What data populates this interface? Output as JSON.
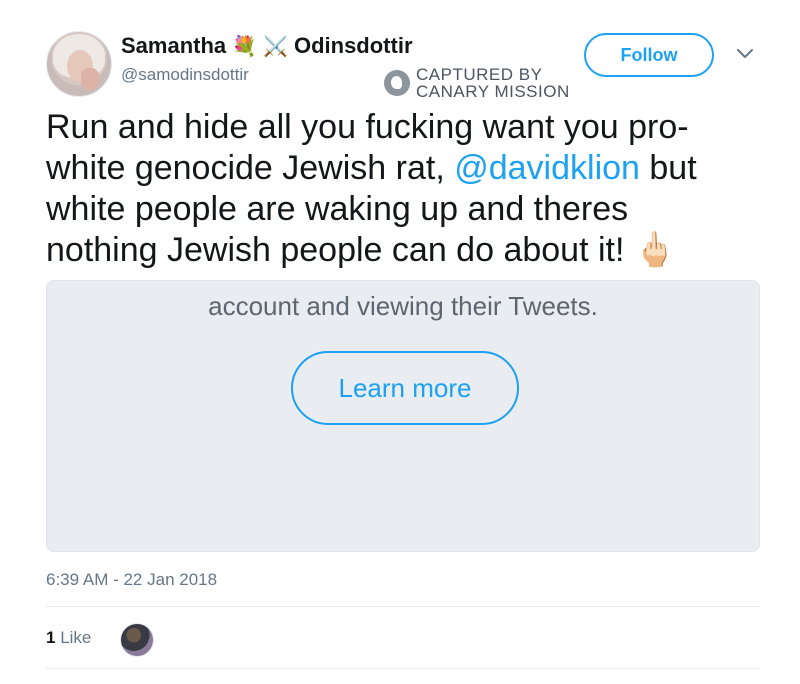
{
  "author": {
    "name_first": "Samantha",
    "name_last": "Odinsdottir",
    "handle": "@samodinsdottir",
    "emoji_1": "💐",
    "emoji_2": "⚔️"
  },
  "follow_button": {
    "label": "Follow"
  },
  "watermark": {
    "line1": "CAPTURED BY",
    "line2": "CANARY MISSION"
  },
  "tweet": {
    "text_before": "Run and hide all you fucking want you pro-white genocide Jewish rat, ",
    "mention": "@davidklion",
    "text_after": " but white people are waking up and theres nothing Jewish people can do about it! ",
    "trailing_emoji": "🖕🏻"
  },
  "card": {
    "text": "account and viewing their Tweets.",
    "button_label": "Learn more"
  },
  "timestamp": "6:39 AM - 22 Jan 2018",
  "engagement": {
    "like_count": "1",
    "like_label": "Like"
  },
  "colors": {
    "accent": "#1da1f2",
    "secondary_text": "#657786",
    "card_bg": "#e9ecf0"
  },
  "icons": {
    "caret": "chevron-down-icon",
    "watermark_logo": "canary-logo-icon"
  }
}
